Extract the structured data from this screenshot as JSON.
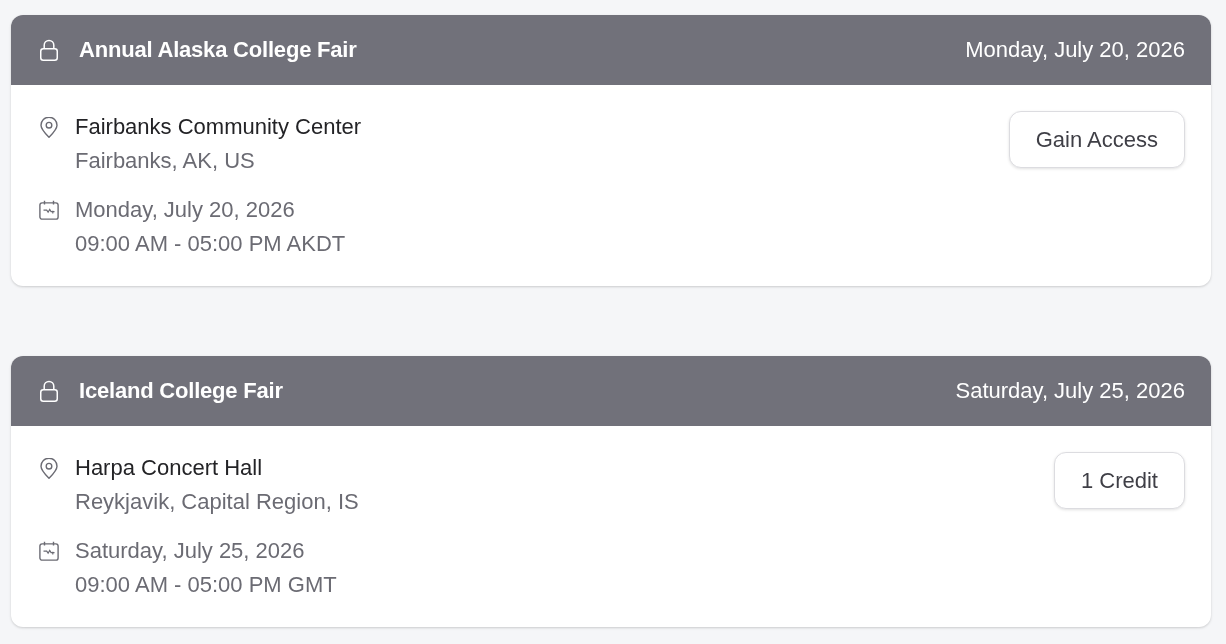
{
  "events": [
    {
      "title": "Annual Alaska College Fair",
      "header_date": "Monday, July 20, 2026",
      "locked": true,
      "venue": "Fairbanks Community Center",
      "address": "Fairbanks, AK, US",
      "date": "Monday, July 20, 2026",
      "time": "09:00 AM - 05:00 PM AKDT",
      "action": "Gain Access"
    },
    {
      "title": "Iceland College Fair",
      "header_date": "Saturday, July 25, 2026",
      "locked": true,
      "venue": "Harpa Concert Hall",
      "address": "Reykjavik, Capital Region, IS",
      "date": "Saturday, July 25, 2026",
      "time": "09:00 AM - 05:00 PM GMT",
      "action": "1 Credit"
    }
  ]
}
